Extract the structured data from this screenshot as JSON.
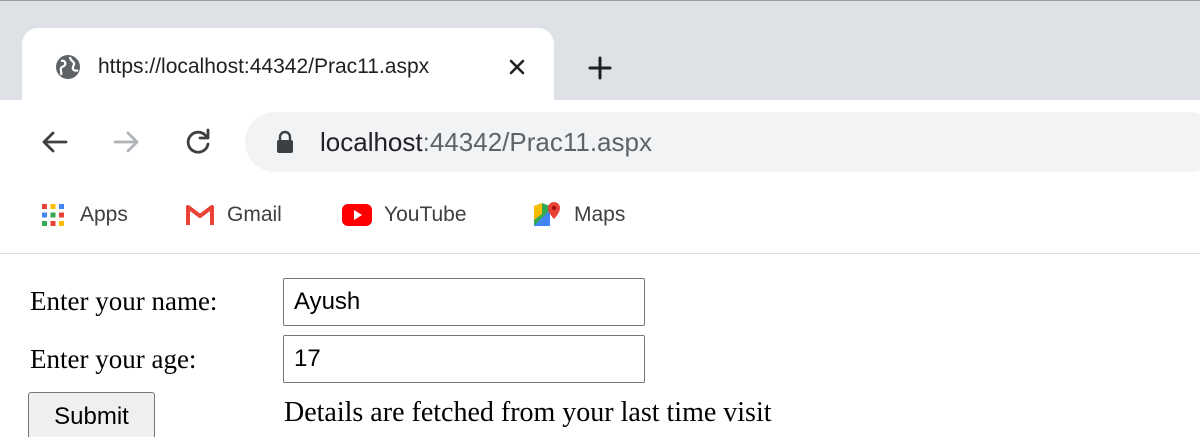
{
  "tab": {
    "title": "https://localhost:44342/Prac11.aspx",
    "icon": "globe-icon"
  },
  "toolbar": {
    "back_icon": "back-arrow-icon",
    "forward_icon": "forward-arrow-icon",
    "reload_icon": "reload-icon",
    "url_host": "localhost",
    "url_rest": ":44342/Prac11.aspx"
  },
  "bookmarks": [
    {
      "label": "Apps",
      "icon": "apps-grid-icon"
    },
    {
      "label": "Gmail",
      "icon": "gmail-icon"
    },
    {
      "label": "YouTube",
      "icon": "youtube-icon"
    },
    {
      "label": "Maps",
      "icon": "maps-icon"
    }
  ],
  "form": {
    "name_label": "Enter your name:",
    "name_value": "Ayush",
    "age_label": "Enter your age:",
    "age_value": "17",
    "submit_label": "Submit",
    "message": "Details are fetched from your last time visit"
  },
  "colors": {
    "tabstrip_bg": "#dee1e6",
    "omnibox_bg": "#f1f3f4",
    "youtube_red": "#ff0000",
    "gmail_red": "#ea4335"
  }
}
